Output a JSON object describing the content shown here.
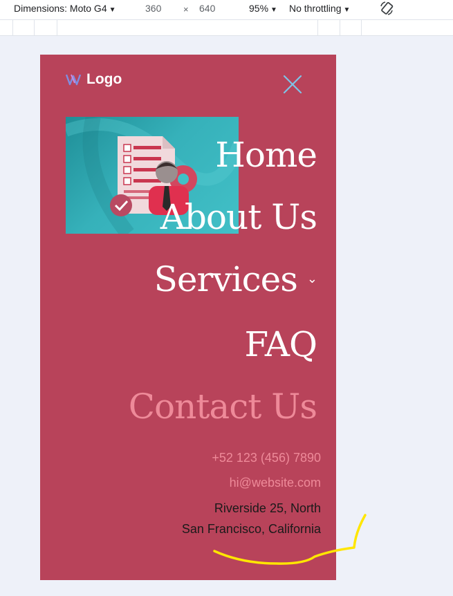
{
  "devtools": {
    "dimensions_label": "Dimensions: Moto G4",
    "width": "360",
    "height": "640",
    "x_sep": "×",
    "zoom": "95%",
    "throttling": "No throttling"
  },
  "site": {
    "logo_text": "Logo",
    "nav": [
      {
        "label": "Home"
      },
      {
        "label": "About Us"
      },
      {
        "label": "Services"
      },
      {
        "label": "FAQ"
      },
      {
        "label": "Contact Us"
      }
    ],
    "contact": {
      "phone": "+52 123 (456) 7890",
      "email": "hi@website.com",
      "address_line1": "Riverside 25, North",
      "address_line2": "San Francisco, California"
    },
    "colors": {
      "background": "#b8435a",
      "accent": "#ee8a99",
      "text": "#ffffff"
    }
  }
}
